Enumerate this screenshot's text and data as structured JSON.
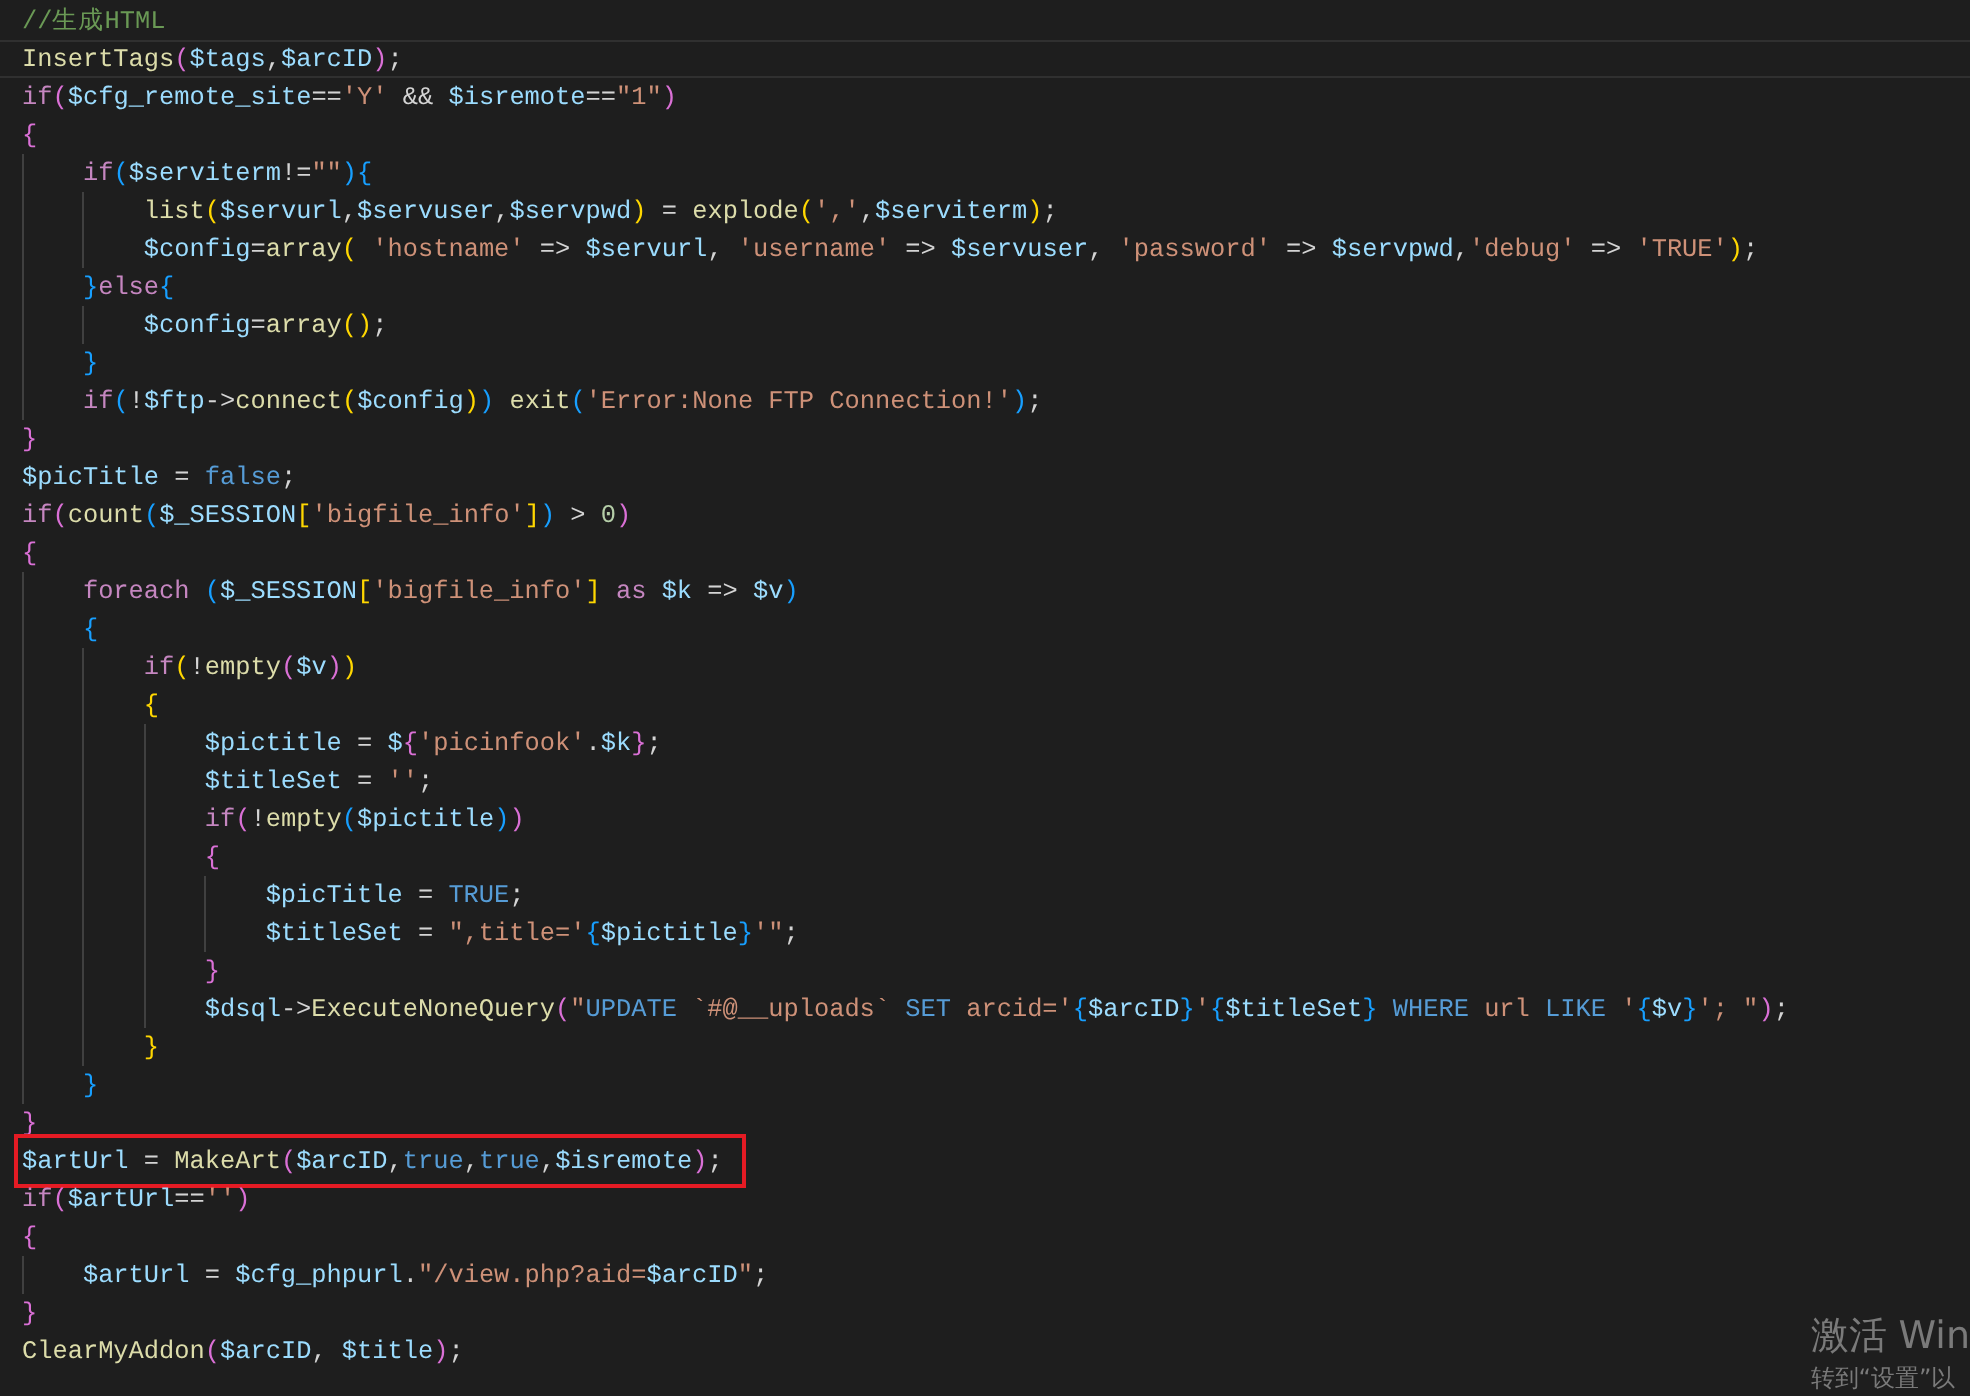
{
  "lines": [
    {
      "current": false,
      "boxed": false,
      "tokens": [
        {
          "kind": "cmt",
          "text": "//生成HTML"
        }
      ]
    },
    {
      "current": true,
      "boxed": false,
      "tokens": [
        {
          "kind": "fn",
          "text": "InsertTags"
        },
        {
          "kind": "b0",
          "text": "("
        },
        {
          "kind": "var",
          "text": "$tags"
        },
        {
          "kind": "op",
          "text": ","
        },
        {
          "kind": "var",
          "text": "$arcID"
        },
        {
          "kind": "b0",
          "text": ")"
        },
        {
          "kind": "op",
          "text": ";"
        }
      ]
    },
    {
      "current": false,
      "boxed": false,
      "tokens": [
        {
          "kind": "kw",
          "text": "if"
        },
        {
          "kind": "b0",
          "text": "("
        },
        {
          "kind": "var",
          "text": "$cfg_remote_site"
        },
        {
          "kind": "op",
          "text": "=="
        },
        {
          "kind": "str",
          "text": "'Y'"
        },
        {
          "kind": "op",
          "text": " && "
        },
        {
          "kind": "var",
          "text": "$isremote"
        },
        {
          "kind": "op",
          "text": "=="
        },
        {
          "kind": "str",
          "text": "\"1\""
        },
        {
          "kind": "b0",
          "text": ")"
        }
      ]
    },
    {
      "current": false,
      "boxed": false,
      "tokens": [
        {
          "kind": "b0",
          "text": "{"
        }
      ],
      "children": [
        {
          "current": false,
          "boxed": false,
          "tokens": [
            {
              "kind": "kw",
              "text": "if"
            },
            {
              "kind": "b1",
              "text": "("
            },
            {
              "kind": "var",
              "text": "$serviterm"
            },
            {
              "kind": "op",
              "text": "!="
            },
            {
              "kind": "str",
              "text": "\"\""
            },
            {
              "kind": "b1",
              "text": ")"
            },
            {
              "kind": "b1",
              "text": "{"
            }
          ],
          "children": [
            {
              "current": false,
              "boxed": false,
              "tokens": [
                {
                  "kind": "fn",
                  "text": "list"
                },
                {
                  "kind": "b2",
                  "text": "("
                },
                {
                  "kind": "var",
                  "text": "$servurl"
                },
                {
                  "kind": "op",
                  "text": ","
                },
                {
                  "kind": "var",
                  "text": "$servuser"
                },
                {
                  "kind": "op",
                  "text": ","
                },
                {
                  "kind": "var",
                  "text": "$servpwd"
                },
                {
                  "kind": "b2",
                  "text": ")"
                },
                {
                  "kind": "op",
                  "text": " = "
                },
                {
                  "kind": "fn",
                  "text": "explode"
                },
                {
                  "kind": "b2",
                  "text": "("
                },
                {
                  "kind": "str",
                  "text": "','"
                },
                {
                  "kind": "op",
                  "text": ","
                },
                {
                  "kind": "var",
                  "text": "$serviterm"
                },
                {
                  "kind": "b2",
                  "text": ")"
                },
                {
                  "kind": "op",
                  "text": ";"
                }
              ]
            },
            {
              "current": false,
              "boxed": false,
              "tokens": [
                {
                  "kind": "var",
                  "text": "$config"
                },
                {
                  "kind": "op",
                  "text": "="
                },
                {
                  "kind": "fn",
                  "text": "array"
                },
                {
                  "kind": "b2",
                  "text": "("
                },
                {
                  "kind": "str",
                  "text": " 'hostname'"
                },
                {
                  "kind": "op",
                  "text": " => "
                },
                {
                  "kind": "var",
                  "text": "$servurl"
                },
                {
                  "kind": "op",
                  "text": ", "
                },
                {
                  "kind": "str",
                  "text": "'username'"
                },
                {
                  "kind": "op",
                  "text": " => "
                },
                {
                  "kind": "var",
                  "text": "$servuser"
                },
                {
                  "kind": "op",
                  "text": ", "
                },
                {
                  "kind": "str",
                  "text": "'password'"
                },
                {
                  "kind": "op",
                  "text": " => "
                },
                {
                  "kind": "var",
                  "text": "$servpwd"
                },
                {
                  "kind": "op",
                  "text": ","
                },
                {
                  "kind": "str",
                  "text": "'debug'"
                },
                {
                  "kind": "op",
                  "text": " => "
                },
                {
                  "kind": "str",
                  "text": "'TRUE'"
                },
                {
                  "kind": "b2",
                  "text": ")"
                },
                {
                  "kind": "op",
                  "text": ";"
                }
              ]
            }
          ]
        },
        {
          "current": false,
          "boxed": false,
          "tokens": [
            {
              "kind": "b1",
              "text": "}"
            },
            {
              "kind": "kw",
              "text": "else"
            },
            {
              "kind": "b1",
              "text": "{"
            }
          ],
          "children": [
            {
              "current": false,
              "boxed": false,
              "tokens": [
                {
                  "kind": "var",
                  "text": "$config"
                },
                {
                  "kind": "op",
                  "text": "="
                },
                {
                  "kind": "fn",
                  "text": "array"
                },
                {
                  "kind": "b2",
                  "text": "("
                },
                {
                  "kind": "b2",
                  "text": ")"
                },
                {
                  "kind": "op",
                  "text": ";"
                }
              ]
            }
          ]
        },
        {
          "current": false,
          "boxed": false,
          "tokens": [
            {
              "kind": "b1",
              "text": "}"
            }
          ]
        },
        {
          "current": false,
          "boxed": false,
          "tokens": [
            {
              "kind": "kw",
              "text": "if"
            },
            {
              "kind": "b1",
              "text": "("
            },
            {
              "kind": "op",
              "text": "!"
            },
            {
              "kind": "var",
              "text": "$ftp"
            },
            {
              "kind": "op",
              "text": "->"
            },
            {
              "kind": "fn",
              "text": "connect"
            },
            {
              "kind": "b2",
              "text": "("
            },
            {
              "kind": "var",
              "text": "$config"
            },
            {
              "kind": "b2",
              "text": ")"
            },
            {
              "kind": "b1",
              "text": ")"
            },
            {
              "kind": "fn",
              "text": " exit"
            },
            {
              "kind": "b1",
              "text": "("
            },
            {
              "kind": "str",
              "text": "'Error:None FTP Connection!'"
            },
            {
              "kind": "b1",
              "text": ")"
            },
            {
              "kind": "op",
              "text": ";"
            }
          ]
        }
      ]
    },
    {
      "current": false,
      "boxed": false,
      "tokens": [
        {
          "kind": "b0",
          "text": "}"
        }
      ]
    },
    {
      "current": false,
      "boxed": false,
      "tokens": [
        {
          "kind": "var",
          "text": "$picTitle"
        },
        {
          "kind": "op",
          "text": " = "
        },
        {
          "kind": "const",
          "text": "false"
        },
        {
          "kind": "op",
          "text": ";"
        }
      ]
    },
    {
      "current": false,
      "boxed": false,
      "tokens": [
        {
          "kind": "kw",
          "text": "if"
        },
        {
          "kind": "b0",
          "text": "("
        },
        {
          "kind": "fn",
          "text": "count"
        },
        {
          "kind": "b1",
          "text": "("
        },
        {
          "kind": "var",
          "text": "$_SESSION"
        },
        {
          "kind": "b2",
          "text": "["
        },
        {
          "kind": "str",
          "text": "'bigfile_info'"
        },
        {
          "kind": "b2",
          "text": "]"
        },
        {
          "kind": "b1",
          "text": ")"
        },
        {
          "kind": "op",
          "text": " > "
        },
        {
          "kind": "num",
          "text": "0"
        },
        {
          "kind": "b0",
          "text": ")"
        }
      ]
    },
    {
      "current": false,
      "boxed": false,
      "tokens": [
        {
          "kind": "b0",
          "text": "{"
        }
      ],
      "children": [
        {
          "current": false,
          "boxed": false,
          "tokens": [
            {
              "kind": "kw",
              "text": "foreach"
            },
            {
              "kind": "b1",
              "text": " ("
            },
            {
              "kind": "var",
              "text": "$_SESSION"
            },
            {
              "kind": "b2",
              "text": "["
            },
            {
              "kind": "str",
              "text": "'bigfile_info'"
            },
            {
              "kind": "b2",
              "text": "]"
            },
            {
              "kind": "kw",
              "text": " as"
            },
            {
              "kind": "var",
              "text": " $k"
            },
            {
              "kind": "op",
              "text": " => "
            },
            {
              "kind": "var",
              "text": "$v"
            },
            {
              "kind": "b1",
              "text": ")"
            }
          ]
        },
        {
          "current": false,
          "boxed": false,
          "tokens": [
            {
              "kind": "b1",
              "text": "{"
            }
          ],
          "children": [
            {
              "current": false,
              "boxed": false,
              "tokens": [
                {
                  "kind": "kw",
                  "text": "if"
                },
                {
                  "kind": "b2",
                  "text": "("
                },
                {
                  "kind": "op",
                  "text": "!"
                },
                {
                  "kind": "fn",
                  "text": "empty"
                },
                {
                  "kind": "b0",
                  "text": "("
                },
                {
                  "kind": "var",
                  "text": "$v"
                },
                {
                  "kind": "b0",
                  "text": ")"
                },
                {
                  "kind": "b2",
                  "text": ")"
                }
              ]
            },
            {
              "current": false,
              "boxed": false,
              "tokens": [
                {
                  "kind": "b2",
                  "text": "{"
                }
              ],
              "children": [
                {
                  "current": false,
                  "boxed": false,
                  "tokens": [
                    {
                      "kind": "var",
                      "text": "$pictitle"
                    },
                    {
                      "kind": "op",
                      "text": " = "
                    },
                    {
                      "kind": "var",
                      "text": "$"
                    },
                    {
                      "kind": "b0",
                      "text": "{"
                    },
                    {
                      "kind": "str",
                      "text": "'picinfook'"
                    },
                    {
                      "kind": "op",
                      "text": "."
                    },
                    {
                      "kind": "var",
                      "text": "$k"
                    },
                    {
                      "kind": "b0",
                      "text": "}"
                    },
                    {
                      "kind": "op",
                      "text": ";"
                    }
                  ]
                },
                {
                  "current": false,
                  "boxed": false,
                  "tokens": [
                    {
                      "kind": "var",
                      "text": "$titleSet"
                    },
                    {
                      "kind": "op",
                      "text": " = "
                    },
                    {
                      "kind": "str",
                      "text": "''"
                    },
                    {
                      "kind": "op",
                      "text": ";"
                    }
                  ]
                },
                {
                  "current": false,
                  "boxed": false,
                  "tokens": [
                    {
                      "kind": "kw",
                      "text": "if"
                    },
                    {
                      "kind": "b0",
                      "text": "("
                    },
                    {
                      "kind": "op",
                      "text": "!"
                    },
                    {
                      "kind": "fn",
                      "text": "empty"
                    },
                    {
                      "kind": "b1",
                      "text": "("
                    },
                    {
                      "kind": "var",
                      "text": "$pictitle"
                    },
                    {
                      "kind": "b1",
                      "text": ")"
                    },
                    {
                      "kind": "b0",
                      "text": ")"
                    }
                  ]
                },
                {
                  "current": false,
                  "boxed": false,
                  "tokens": [
                    {
                      "kind": "b0",
                      "text": "{"
                    }
                  ],
                  "children": [
                    {
                      "current": false,
                      "boxed": false,
                      "tokens": [
                        {
                          "kind": "var",
                          "text": "$picTitle"
                        },
                        {
                          "kind": "op",
                          "text": " = "
                        },
                        {
                          "kind": "const",
                          "text": "TRUE"
                        },
                        {
                          "kind": "op",
                          "text": ";"
                        }
                      ]
                    },
                    {
                      "current": false,
                      "boxed": false,
                      "tokens": [
                        {
                          "kind": "var",
                          "text": "$titleSet"
                        },
                        {
                          "kind": "op",
                          "text": " = "
                        },
                        {
                          "kind": "str",
                          "text": "\",title='"
                        },
                        {
                          "kind": "b1",
                          "text": "{"
                        },
                        {
                          "kind": "var",
                          "text": "$pictitle"
                        },
                        {
                          "kind": "b1",
                          "text": "}"
                        },
                        {
                          "kind": "str",
                          "text": "'\""
                        },
                        {
                          "kind": "op",
                          "text": ";"
                        }
                      ]
                    }
                  ]
                },
                {
                  "current": false,
                  "boxed": false,
                  "tokens": [
                    {
                      "kind": "b0",
                      "text": "}"
                    }
                  ]
                },
                {
                  "current": false,
                  "boxed": false,
                  "tokens": [
                    {
                      "kind": "var",
                      "text": "$dsql"
                    },
                    {
                      "kind": "op",
                      "text": "->"
                    },
                    {
                      "kind": "fn",
                      "text": "ExecuteNoneQuery"
                    },
                    {
                      "kind": "b0",
                      "text": "("
                    },
                    {
                      "kind": "str",
                      "text": "\""
                    },
                    {
                      "kind": "sql",
                      "text": "UPDATE"
                    },
                    {
                      "kind": "str",
                      "text": " `#@__uploads` "
                    },
                    {
                      "kind": "sql",
                      "text": "SET"
                    },
                    {
                      "kind": "str",
                      "text": " arcid='"
                    },
                    {
                      "kind": "b1",
                      "text": "{"
                    },
                    {
                      "kind": "var",
                      "text": "$arcID"
                    },
                    {
                      "kind": "b1",
                      "text": "}"
                    },
                    {
                      "kind": "str",
                      "text": "'"
                    },
                    {
                      "kind": "b1",
                      "text": "{"
                    },
                    {
                      "kind": "var",
                      "text": "$titleSet"
                    },
                    {
                      "kind": "b1",
                      "text": "}"
                    },
                    {
                      "kind": "sql",
                      "text": " WHERE"
                    },
                    {
                      "kind": "str",
                      "text": " url "
                    },
                    {
                      "kind": "sql",
                      "text": "LIKE"
                    },
                    {
                      "kind": "str",
                      "text": " '"
                    },
                    {
                      "kind": "b1",
                      "text": "{"
                    },
                    {
                      "kind": "var",
                      "text": "$v"
                    },
                    {
                      "kind": "b1",
                      "text": "}"
                    },
                    {
                      "kind": "str",
                      "text": "'; \""
                    },
                    {
                      "kind": "b0",
                      "text": ")"
                    },
                    {
                      "kind": "op",
                      "text": ";"
                    }
                  ]
                }
              ]
            },
            {
              "current": false,
              "boxed": false,
              "tokens": [
                {
                  "kind": "b2",
                  "text": "}"
                }
              ]
            }
          ]
        },
        {
          "current": false,
          "boxed": false,
          "tokens": [
            {
              "kind": "b1",
              "text": "}"
            }
          ]
        }
      ]
    },
    {
      "current": false,
      "boxed": false,
      "tokens": [
        {
          "kind": "b0",
          "text": "}"
        }
      ]
    },
    {
      "current": false,
      "boxed": true,
      "tokens": [
        {
          "kind": "var",
          "text": "$artUrl"
        },
        {
          "kind": "op",
          "text": " = "
        },
        {
          "kind": "fn",
          "text": "MakeArt"
        },
        {
          "kind": "b0",
          "text": "("
        },
        {
          "kind": "var",
          "text": "$arcID"
        },
        {
          "kind": "op",
          "text": ","
        },
        {
          "kind": "const",
          "text": "true"
        },
        {
          "kind": "op",
          "text": ","
        },
        {
          "kind": "const",
          "text": "true"
        },
        {
          "kind": "op",
          "text": ","
        },
        {
          "kind": "var",
          "text": "$isremote"
        },
        {
          "kind": "b0",
          "text": ")"
        },
        {
          "kind": "op",
          "text": ";"
        }
      ]
    },
    {
      "current": false,
      "boxed": false,
      "tokens": [
        {
          "kind": "kw",
          "text": "if"
        },
        {
          "kind": "b0",
          "text": "("
        },
        {
          "kind": "var",
          "text": "$artUrl"
        },
        {
          "kind": "op",
          "text": "=="
        },
        {
          "kind": "str",
          "text": "''"
        },
        {
          "kind": "b0",
          "text": ")"
        }
      ]
    },
    {
      "current": false,
      "boxed": false,
      "tokens": [
        {
          "kind": "b0",
          "text": "{"
        }
      ],
      "children": [
        {
          "current": false,
          "boxed": false,
          "tokens": [
            {
              "kind": "var",
              "text": "$artUrl"
            },
            {
              "kind": "op",
              "text": " = "
            },
            {
              "kind": "var",
              "text": "$cfg_phpurl"
            },
            {
              "kind": "op",
              "text": "."
            },
            {
              "kind": "str",
              "text": "\"/view.php?aid="
            },
            {
              "kind": "var",
              "text": "$arcID"
            },
            {
              "kind": "str",
              "text": "\""
            },
            {
              "kind": "op",
              "text": ";"
            }
          ]
        }
      ]
    },
    {
      "current": false,
      "boxed": false,
      "tokens": [
        {
          "kind": "b0",
          "text": "}"
        }
      ]
    },
    {
      "current": false,
      "boxed": false,
      "tokens": [
        {
          "kind": "fn",
          "text": "ClearMyAddon"
        },
        {
          "kind": "b0",
          "text": "("
        },
        {
          "kind": "var",
          "text": "$arcID"
        },
        {
          "kind": "op",
          "text": ", "
        },
        {
          "kind": "var",
          "text": "$title"
        },
        {
          "kind": "b0",
          "text": ")"
        },
        {
          "kind": "op",
          "text": ";"
        }
      ]
    }
  ],
  "os_notice": {
    "title": "激活 Win",
    "subtitle": "转到“设置”以"
  }
}
